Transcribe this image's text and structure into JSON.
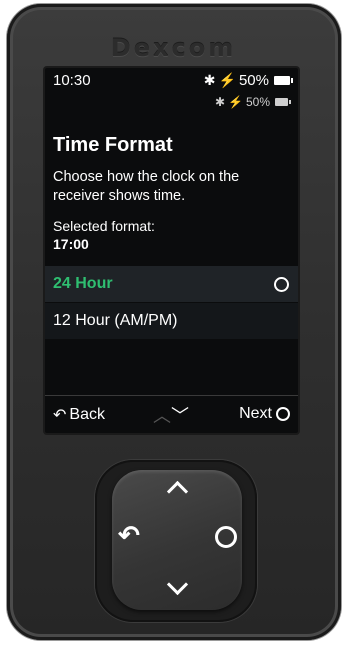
{
  "device": {
    "brand": "Dexcom"
  },
  "status": {
    "time": "10:30",
    "bluetooth_icon": "bluetooth-icon",
    "charging_icon": "charging-bolt-icon",
    "battery": "50%",
    "battery_secondary": "50%"
  },
  "screen": {
    "title": "Time Format",
    "description": "Choose how the clock on the receiver shows time.",
    "selected_label": "Selected format:",
    "selected_value": "17:00",
    "options": [
      {
        "label": "24 Hour",
        "selected": true
      },
      {
        "label": "12 Hour (AM/PM)",
        "selected": false
      }
    ]
  },
  "softkeys": {
    "back": "Back",
    "next": "Next"
  },
  "colors": {
    "accent_green": "#2fbf71",
    "screen_bg": "#0b0c0d",
    "device_body": "#2f2f2f"
  }
}
